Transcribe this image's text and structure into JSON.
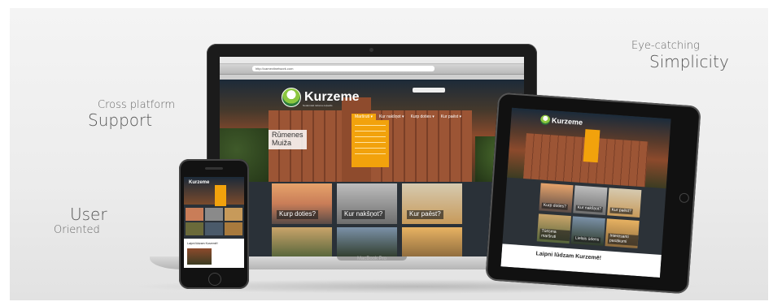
{
  "taglines": {
    "eye_catching_small": "Eye-catching",
    "eye_catching_big": "Simplicity",
    "cross_small": "Cross platform",
    "cross_big": "Support",
    "user_big": "User",
    "user_small": "Oriented"
  },
  "laptop": {
    "brand": "MacBook Pro",
    "url": "http://camexitnetwork.com",
    "site": {
      "logo": "Kurzeme",
      "logo_sub": "Noderniski tūrisma ceļvedis",
      "nav": [
        "Maršruti ▾",
        "Kur nakšņot ▾",
        "Kurp doties ▾",
        "Kur paēst ▾"
      ],
      "hero_title_line1": "Rūmenes",
      "hero_title_line2": "Muiža",
      "tiles": [
        "Kurp doties?",
        "Kur nakšņot?",
        "Kur paēst?"
      ]
    }
  },
  "tablet": {
    "logo": "Kurzeme",
    "tiles": [
      "Kurp doties?",
      "Kur nakšņot?",
      "Kur paēst?",
      "Tūrisma maršruti",
      "Lielais ūdens",
      "Interesanti pasākumi"
    ],
    "welcome": "Laipni lūdzam Kurzemē!"
  },
  "phone": {
    "logo": "Kurzeme",
    "text": "Laipni lūdzam Kurzemē!"
  }
}
